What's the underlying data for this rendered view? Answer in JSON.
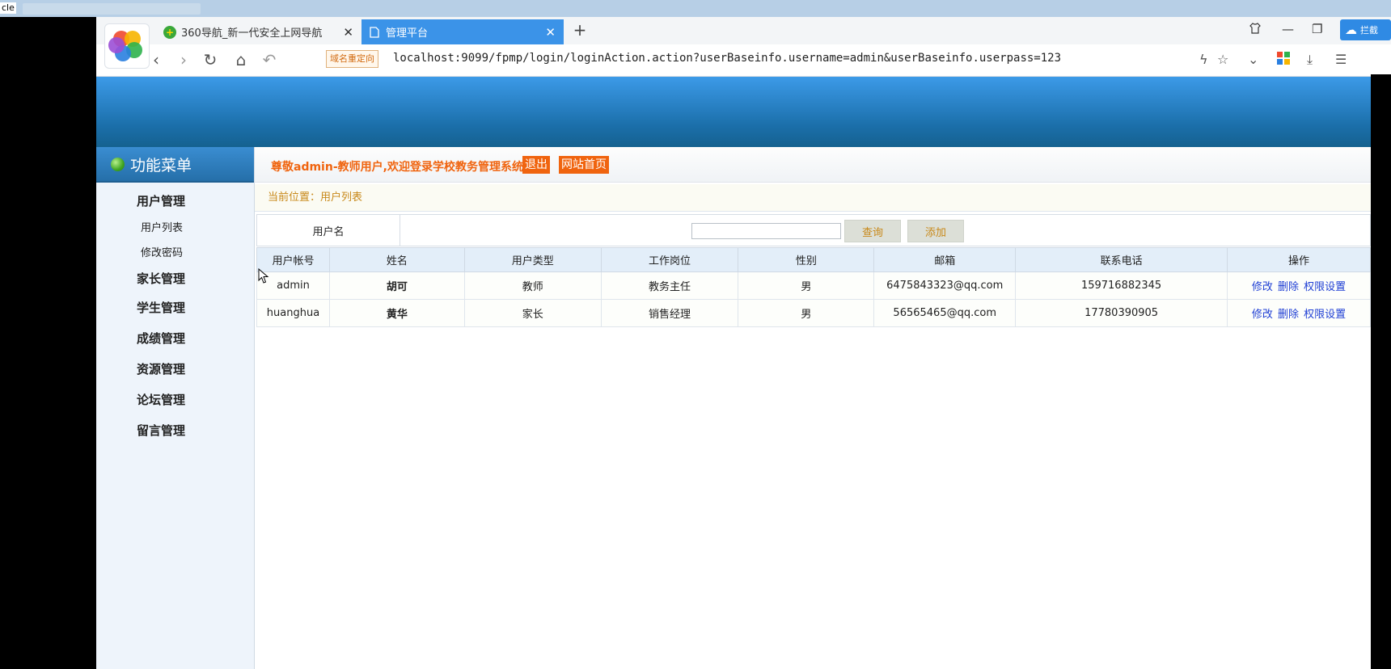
{
  "os": {
    "label": "cle"
  },
  "browser": {
    "tabs": [
      {
        "title": "360导航_新一代安全上网导航",
        "active": false
      },
      {
        "title": "管理平台",
        "active": true
      }
    ],
    "extra_btn_label": "拦截",
    "redirect_badge": "域名重定向",
    "url": "localhost:9099/fpmp/login/loginAction.action?userBaseinfo.username=admin&userBaseinfo.userpass=123"
  },
  "sidebar": {
    "title": "功能菜单",
    "items": [
      {
        "label": "用户管理"
      },
      {
        "label": "用户列表",
        "sub": true
      },
      {
        "label": "修改密码",
        "sub": true
      },
      {
        "label": "家长管理"
      },
      {
        "label": "学生管理"
      },
      {
        "label": "成绩管理"
      },
      {
        "label": "资源管理"
      },
      {
        "label": "论坛管理"
      },
      {
        "label": "留言管理"
      }
    ]
  },
  "header": {
    "welcome": "尊敬admin-教师用户,欢迎登录学校教务管理系统",
    "logout": "退出",
    "home": "网站首页"
  },
  "breadcrumb": "当前位置：用户列表",
  "search": {
    "label": "用户名",
    "value": "",
    "query_button": "查询",
    "add_button": "添加"
  },
  "table": {
    "columns": [
      "用户帐号",
      "姓名",
      "用户类型",
      "工作岗位",
      "性别",
      "邮箱",
      "联系电话",
      "操作"
    ],
    "rows": [
      {
        "account": "admin",
        "name": "胡可",
        "type": "教师",
        "job": "教务主任",
        "gender": "男",
        "email": "6475843323@qq.com",
        "phone": "159716882345",
        "ops": [
          "修改",
          "删除",
          "权限设置"
        ]
      },
      {
        "account": "huanghua",
        "name": "黄华",
        "type": "家长",
        "job": "销售经理",
        "gender": "男",
        "email": "56565465@qq.com",
        "phone": "17780390905",
        "ops": [
          "修改",
          "删除",
          "权限设置"
        ]
      }
    ]
  }
}
